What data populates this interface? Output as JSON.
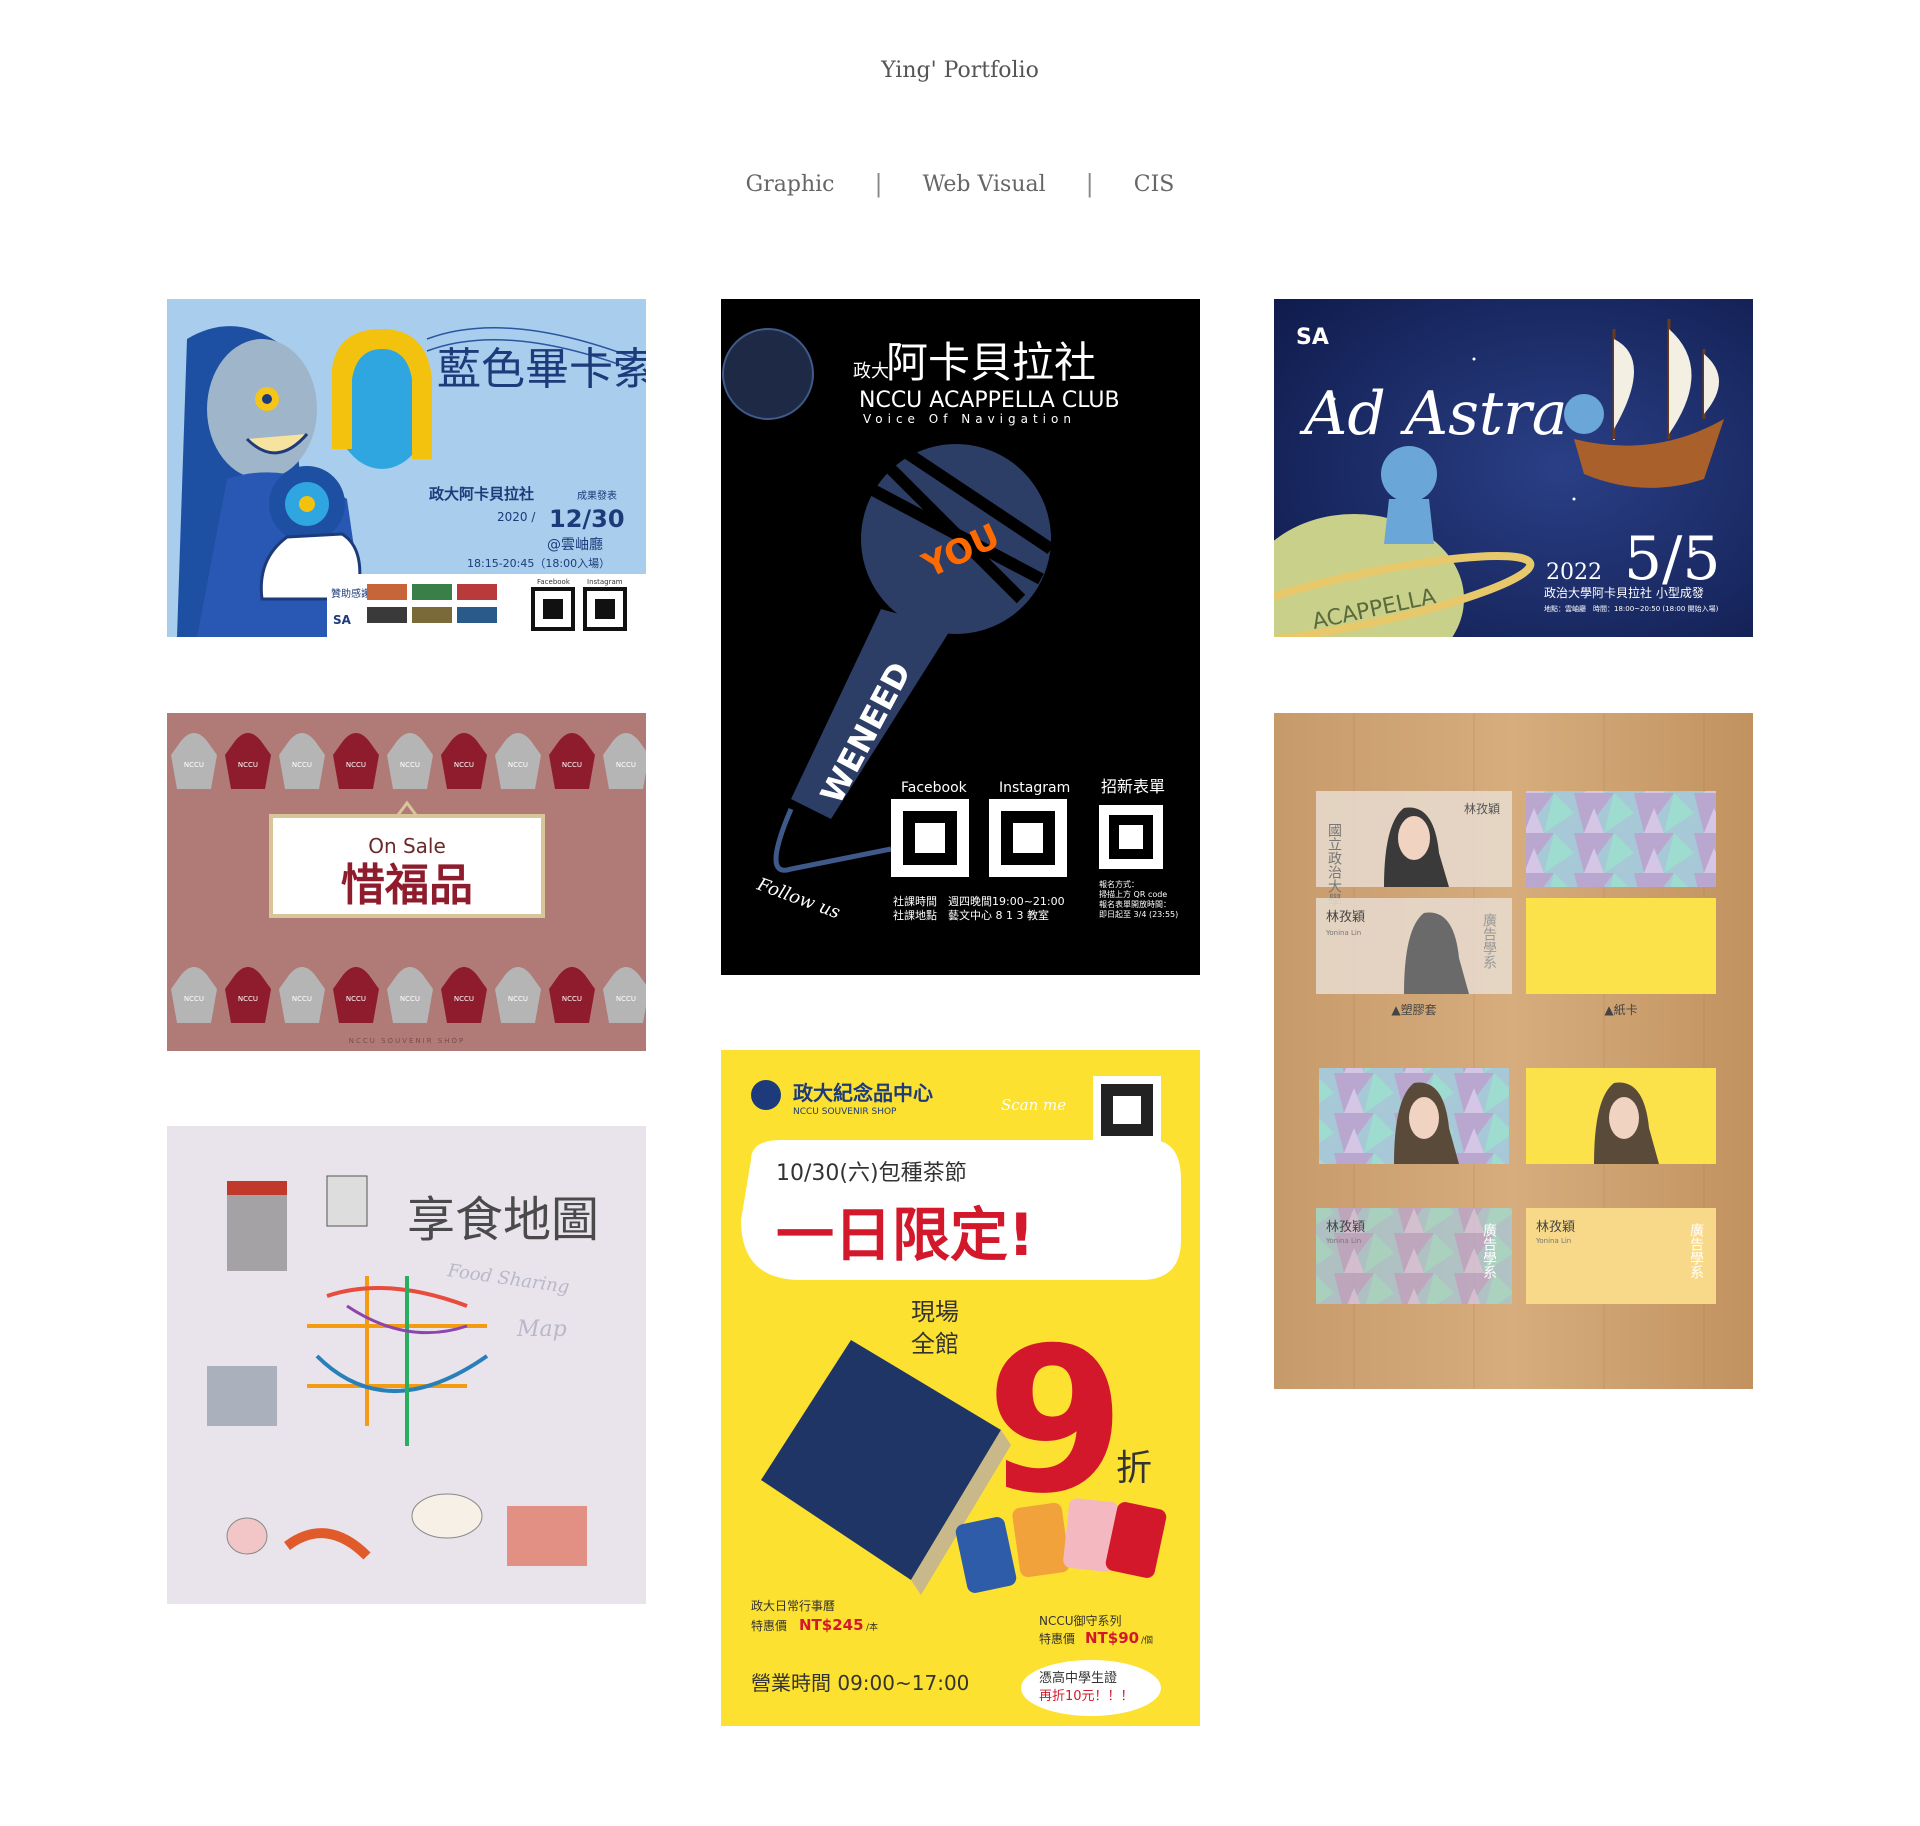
{
  "site": {
    "title": "Ying' Portfolio"
  },
  "nav": {
    "items": [
      "Graphic",
      "Web Visual",
      "CIS"
    ],
    "separator": "|"
  },
  "works": {
    "blue_picasso": {
      "title": "藍色畢卡索",
      "subtitle": "政大阿卡貝拉社",
      "note": "成果發表",
      "year": "2020 /",
      "date": "12/30",
      "venue": "@雲岫廳",
      "time": "18:15-20:45（18:00入場）",
      "sponsor": "贊助感謝",
      "facebook": "Facebook",
      "instagram": "Instagram",
      "badge": "SA"
    },
    "acappella_club": {
      "title_small": "政大",
      "title": "阿卡貝拉社",
      "club_en": "NCCU ACAPPELLA CLUB",
      "tagline": "Voice Of Navigation",
      "we_need": "WENEED",
      "you": "YOU",
      "follow": "Follow us",
      "facebook": "Facebook",
      "instagram": "Instagram",
      "form": "招新表單",
      "schedule": "社課時間　週四晚間19:00~21:00",
      "place": "社課地點　藝文中心 8 1 3 教室",
      "signup": "報名方式：",
      "signup2": "掃描上方 QR code",
      "signup3": "報名表單開放時間：",
      "signup4": "即日起至 3/4 (23:55)"
    },
    "ad_astra": {
      "badge": "SA",
      "title": "Ad Astra",
      "year": "2022",
      "date": "5/5",
      "subtitle": "政治大學阿卡貝拉社 小型成發",
      "detail": "地點：雲岫廳　時間：18:00~20:50 (18:00 開始入場)",
      "planet": "ACAPPELLA"
    },
    "on_sale": {
      "label_en": "On Sale",
      "label_zh": "惜福品",
      "hoodie": "NCCU",
      "footer": "NCCU SOUVENIR SHOP"
    },
    "business_cards": {
      "name": "林孜穎",
      "name_en": "Yonina Lin",
      "dept": "國立政治大學",
      "dept2": "廣告學系",
      "plastic": "▲塑膠套",
      "paper": "▲紙卡"
    },
    "food_map": {
      "title": "享食地圖",
      "en1": "Food Sharing",
      "en2": "Map"
    },
    "tea_festival": {
      "shop": "政大紀念品中心",
      "shop_en": "NCCU SOUVENIR SHOP",
      "scan": "Scan me",
      "event": "10/30(六)包種茶節",
      "headline": "一日限定!",
      "onsite": "現場",
      "all": "全館",
      "discount": "9",
      "zhe": "折",
      "item1": "政大日常行事曆",
      "price1_label": "特惠價",
      "price1": "NT$245",
      "price1_unit": "/本",
      "item2": "NCCU御守系列",
      "price2_label": "特惠價",
      "price2": "NT$90",
      "price2_unit": "/個",
      "hours": "營業時間 09:00~17:00",
      "student1": "憑高中學生證",
      "student2": "再折10元！！！"
    }
  },
  "colors": {
    "nav_text": "#666666",
    "background": "#ffffff"
  }
}
